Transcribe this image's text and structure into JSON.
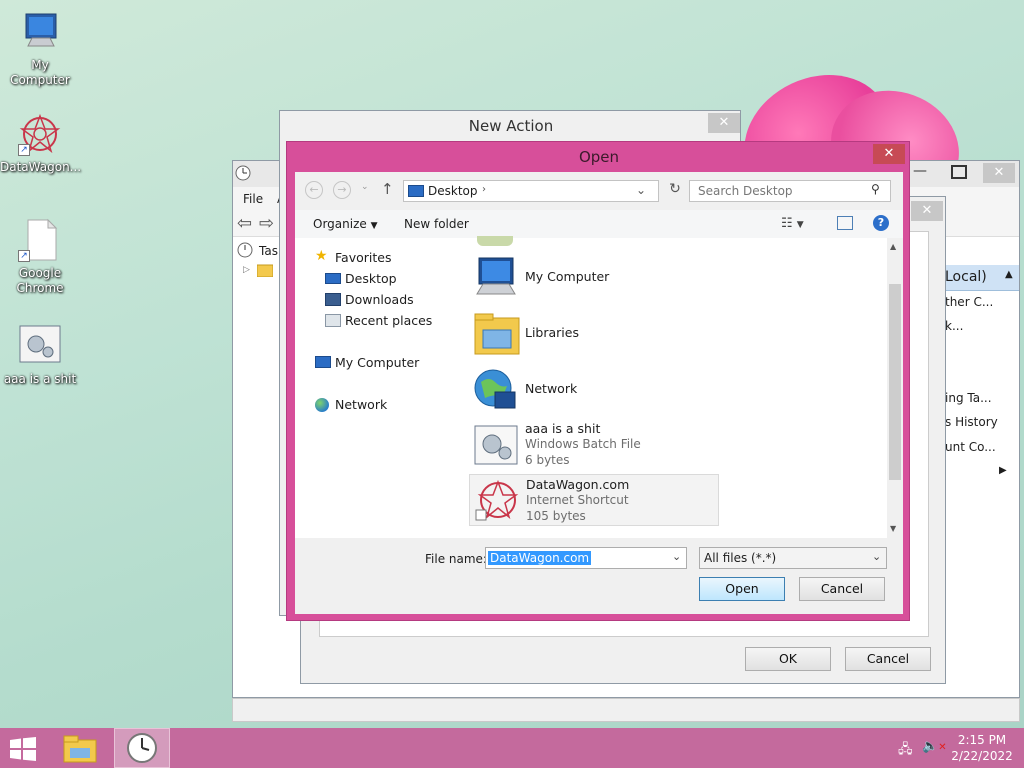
{
  "desktop": {
    "icons": [
      {
        "label": "My Computer",
        "icon": "computer-icon"
      },
      {
        "label": "DataWagon...",
        "icon": "datawagon-icon"
      },
      {
        "label": "Google Chrome",
        "icon": "document-icon"
      },
      {
        "label": "aaa is a shit",
        "icon": "batch-file-icon"
      }
    ]
  },
  "scheduler": {
    "menu_file": "File",
    "menu_a": "A",
    "tree_root": "Tasl",
    "right_items": [
      "Local)",
      "ther C...",
      "k...",
      "ing Ta...",
      "s History",
      "unt Co..."
    ]
  },
  "new_action": {
    "title": "New Action",
    "ok_label": "OK",
    "cancel_label": "Cancel"
  },
  "open_dialog": {
    "title": "Open",
    "address": "Desktop",
    "search_placeholder": "Search Desktop",
    "organize_label": "Organize",
    "new_folder_label": "New folder",
    "nav": {
      "favorites": "Favorites",
      "desktop": "Desktop",
      "downloads": "Downloads",
      "recent": "Recent places",
      "my_computer": "My Computer",
      "network": "Network"
    },
    "files": [
      {
        "name": "My Computer",
        "type": "",
        "size": ""
      },
      {
        "name": "Libraries",
        "type": "",
        "size": ""
      },
      {
        "name": "Network",
        "type": "",
        "size": ""
      },
      {
        "name": "aaa is a shit",
        "type": "Windows Batch File",
        "size": "6 bytes"
      },
      {
        "name": "DataWagon.com",
        "type": "Internet Shortcut",
        "size": "105 bytes"
      }
    ],
    "file_name_label": "File name:",
    "file_name_value": "DataWagon.com",
    "file_type_value": "All files (*.*)",
    "open_label": "Open",
    "cancel_label": "Cancel"
  },
  "taskbar": {
    "time": "2:15 PM",
    "date": "2/22/2022"
  },
  "colors": {
    "dialog_accent": "#d74f9a",
    "taskbar": "#c46a9d",
    "selection": "#3399ff"
  }
}
